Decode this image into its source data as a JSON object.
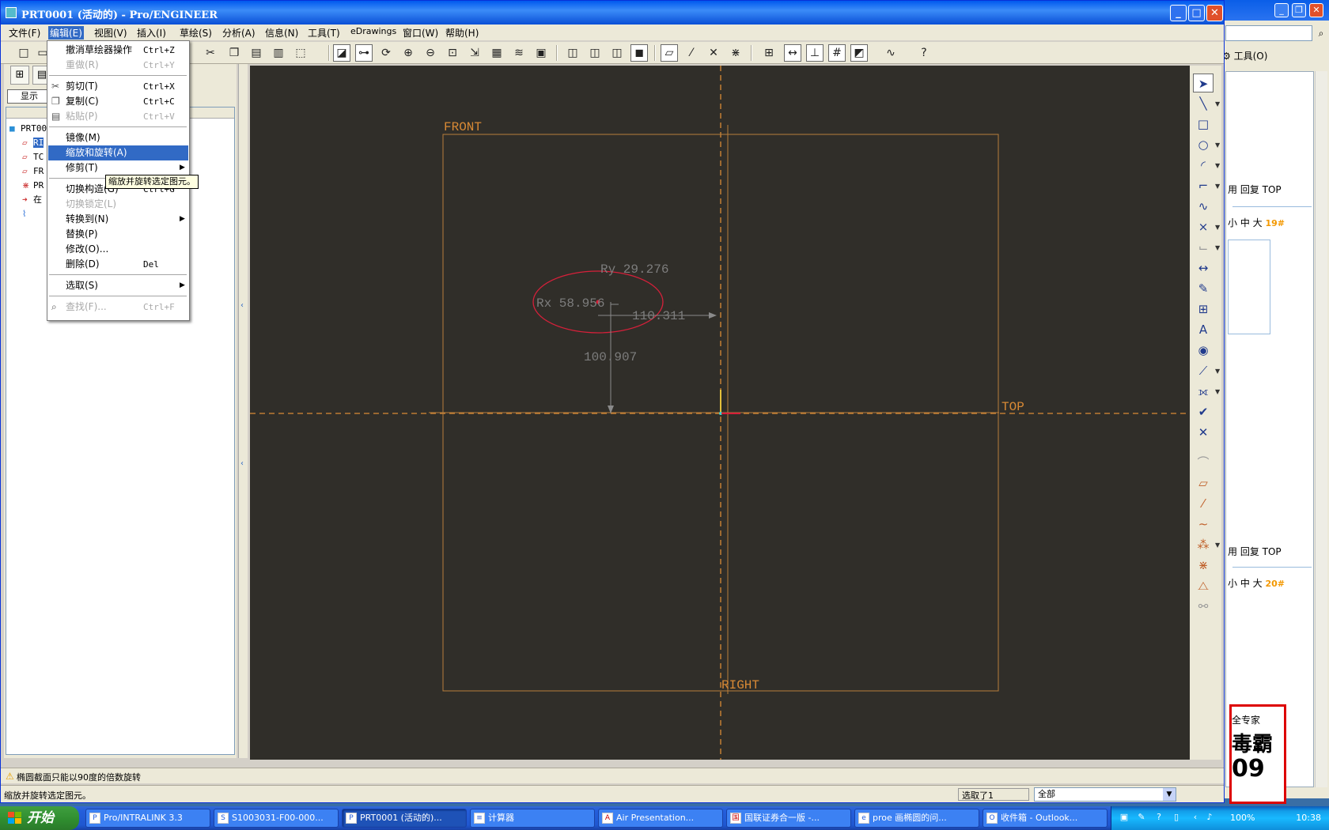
{
  "window": {
    "title": "PRT0001 (活动的) - Pro/ENGINEER"
  },
  "menubar": [
    {
      "label": "文件(F)"
    },
    {
      "label": "编辑(E)"
    },
    {
      "label": "视图(V)"
    },
    {
      "label": "插入(I)"
    },
    {
      "label": "草绘(S)"
    },
    {
      "label": "分析(A)"
    },
    {
      "label": "信息(N)"
    },
    {
      "label": "工具(T)"
    },
    {
      "label": "eDrawings"
    },
    {
      "label": "窗口(W)"
    },
    {
      "label": "帮助(H)"
    }
  ],
  "edit_menu": {
    "items": [
      {
        "label": "撤消草绘器操作",
        "shortcut": "Ctrl+Z"
      },
      {
        "label": "重做(R)",
        "shortcut": "Ctrl+Y"
      },
      {
        "label": "剪切(T)",
        "shortcut": "Ctrl+X"
      },
      {
        "label": "复制(C)",
        "shortcut": "Ctrl+C"
      },
      {
        "label": "粘贴(P)",
        "shortcut": "Ctrl+V"
      },
      {
        "label": "镜像(M)"
      },
      {
        "label": "缩放和旋转(A)"
      },
      {
        "label": "修剪(T)"
      },
      {
        "label": "切换构造(G)",
        "shortcut": "Ctrl+G"
      },
      {
        "label": "切换锁定(L)"
      },
      {
        "label": "转换到(N)"
      },
      {
        "label": "替换(P)"
      },
      {
        "label": "修改(O)..."
      },
      {
        "label": "删除(D)",
        "shortcut": "Del"
      },
      {
        "label": "选取(S)"
      },
      {
        "label": "查找(F)...",
        "shortcut": "Ctrl+F"
      }
    ]
  },
  "tooltip": "缩放并旋转选定图元。",
  "left_panel": {
    "show_button": "显示",
    "tree_items": [
      {
        "label": "PRT00",
        "icon": "part-icon"
      },
      {
        "label": "RI",
        "icon": "datum-plane-icon"
      },
      {
        "label": "TC",
        "icon": "datum-plane-icon"
      },
      {
        "label": "FR",
        "icon": "datum-plane-icon"
      },
      {
        "label": "PR",
        "icon": "csys-icon"
      },
      {
        "label": "在",
        "icon": "insert-here-icon"
      },
      {
        "label": "",
        "icon": "sketch-icon"
      }
    ]
  },
  "sketch": {
    "datum_labels": {
      "front": "FRONT",
      "top": "TOP",
      "right": "RIGHT"
    },
    "dimensions": {
      "ry": "Ry 29.276",
      "rx": "Rx 58.956",
      "horizontal": "110.311",
      "vertical": "100.907"
    },
    "colors": {
      "background": "#302e29",
      "datum": "#d98a35",
      "ellipse": "#d6203a",
      "dimension": "#8a8a8a"
    }
  },
  "status": {
    "message": "椭圆截面只能以90度的倍数旋转",
    "status_text": "缩放并旋转选定图元。",
    "selection_count": "选取了1",
    "filter_value": "全部"
  },
  "background_window": {
    "tools_label": "工具(O)",
    "lines": [
      {
        "text": "用 回复 TOP"
      },
      {
        "text": "小 中 大",
        "num": "19#"
      },
      {
        "text": "用 回复 TOP"
      },
      {
        "text": "小 中 大",
        "num": "20#"
      }
    ],
    "ad_lines": [
      "全专家",
      "毒霸",
      "09"
    ]
  },
  "taskbar": {
    "start_label": "开始",
    "tasks": [
      {
        "label": "Pro/INTRALINK 3.3"
      },
      {
        "label": "S1003031-F00-000..."
      },
      {
        "label": "PRT0001 (活动的)..."
      },
      {
        "label": "计算器"
      },
      {
        "label": "Air Presentation..."
      },
      {
        "label": "国联证券合一版 -..."
      },
      {
        "label": "proe 画椭圆的问..."
      },
      {
        "label": "收件箱 - Outlook..."
      }
    ],
    "zoom": "100%",
    "clock": "10:38"
  }
}
